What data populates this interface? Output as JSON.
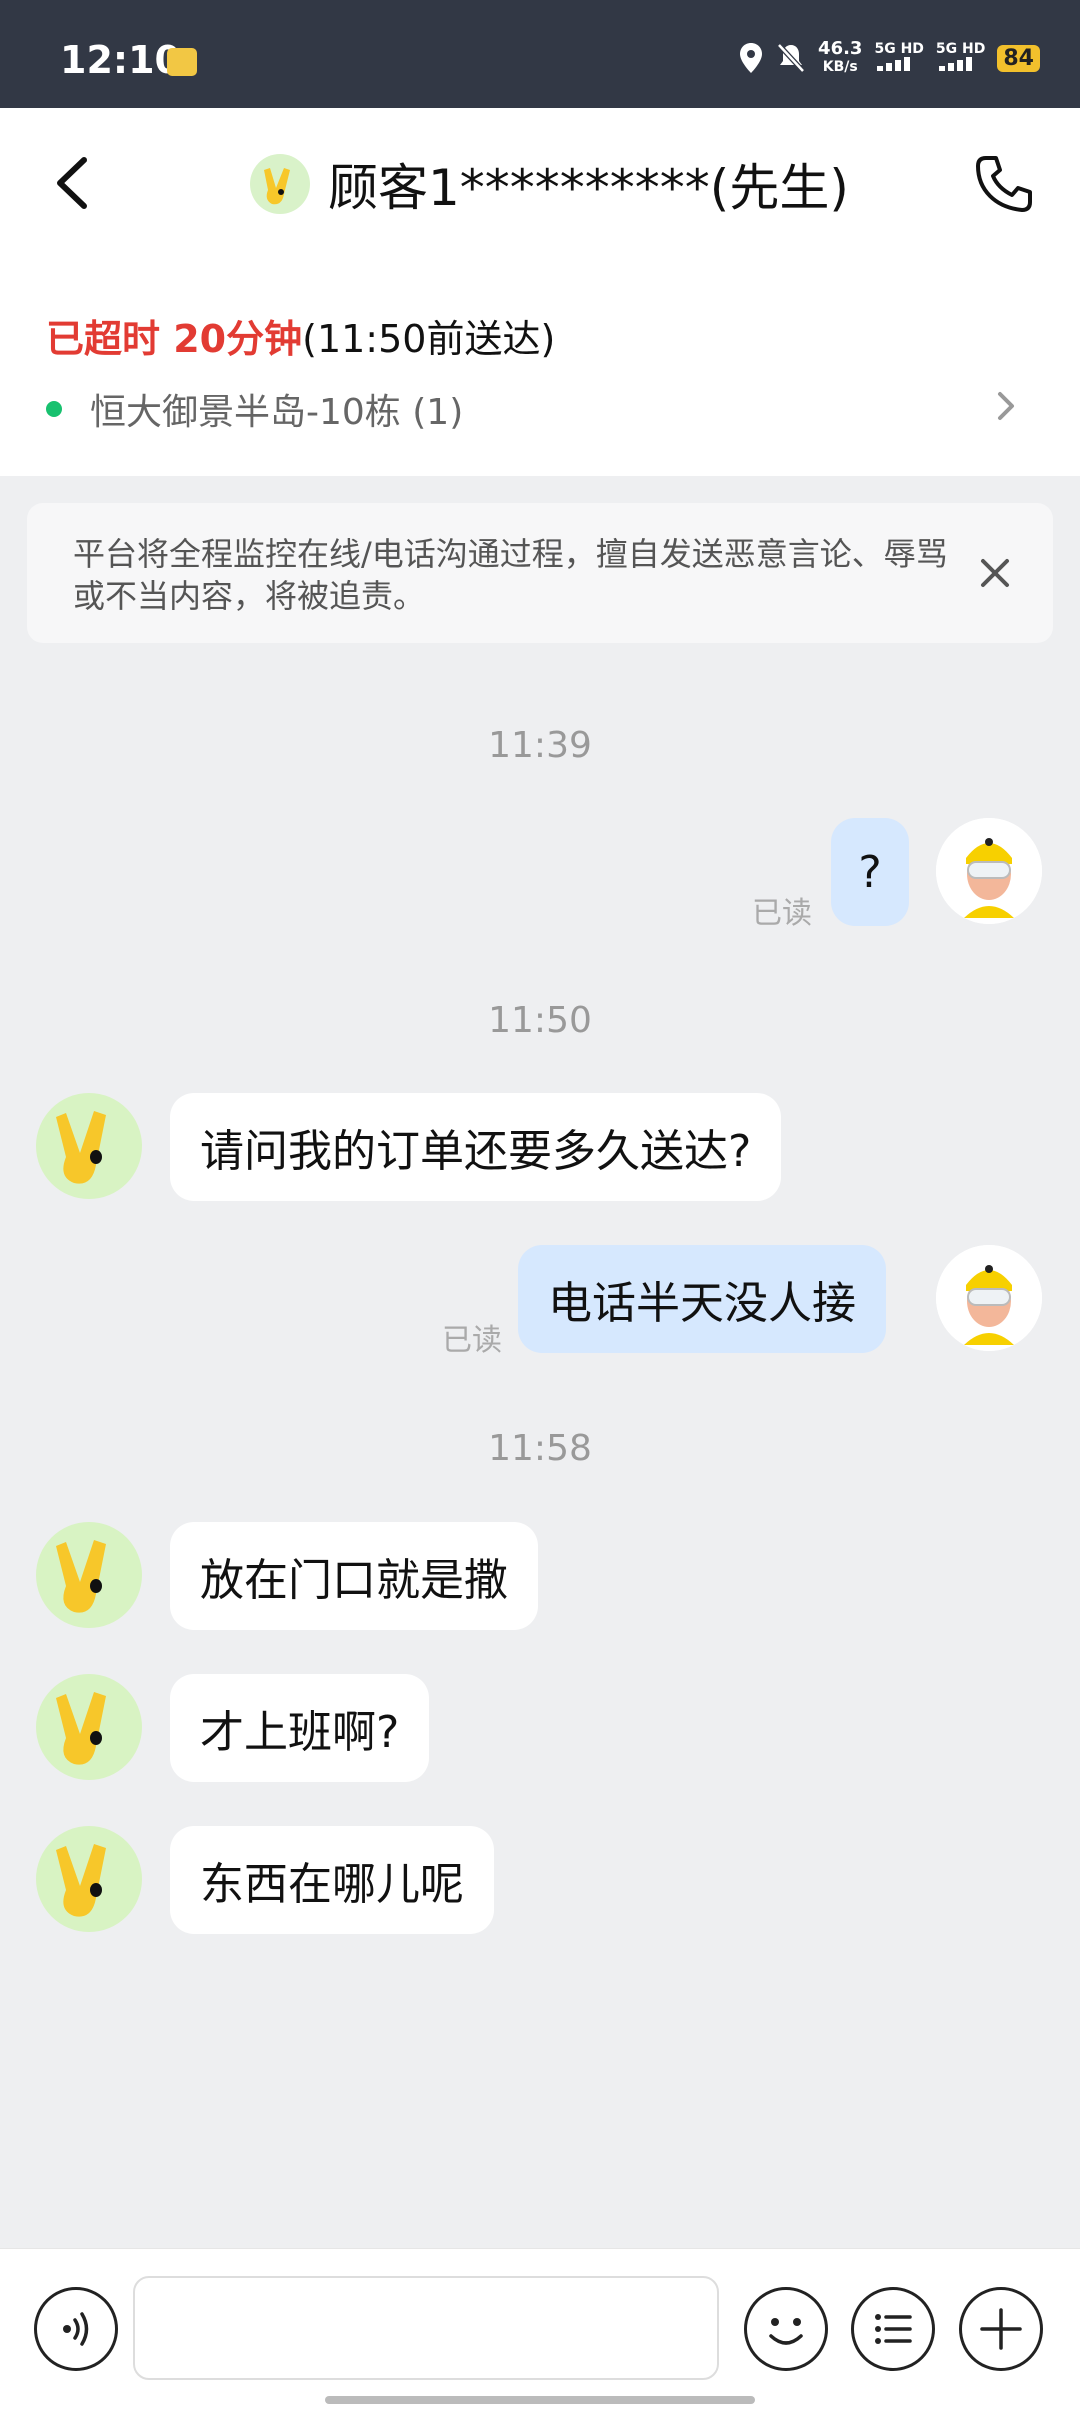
{
  "status_bar": {
    "time": "12:10",
    "speed_value": "46.3",
    "speed_unit": "KB/s",
    "sig1": "5G HD",
    "sig2": "5G HD",
    "battery": "84"
  },
  "header": {
    "title": "顾客1**********(先生)"
  },
  "order": {
    "overdue_text": "已超时 20分钟",
    "deadline_text": "(11:50前送达)",
    "address": "恒大御景半岛-10栋 (1)"
  },
  "notice": {
    "text": "平台将全程监控在线/电话沟通过程，擅自发送恶意言论、辱骂或不当内容，将被追责。"
  },
  "chat": {
    "ts1": "11:39",
    "m1": {
      "text": "?",
      "read": "已读"
    },
    "ts2": "11:50",
    "m2": {
      "text": "请问我的订单还要多久送达?"
    },
    "m3": {
      "text": "电话半天没人接",
      "read": "已读"
    },
    "ts3": "11:58",
    "m4": {
      "text": "放在门口就是撒"
    },
    "m5": {
      "text": "才上班啊?"
    },
    "m6": {
      "text": "东西在哪儿呢"
    }
  },
  "input": {
    "value": ""
  },
  "icons": [
    "back-icon",
    "phone-icon",
    "chevron-right-icon",
    "close-icon",
    "voice-icon",
    "emoji-icon",
    "menu-icon",
    "plus-icon"
  ],
  "colors": {
    "overdue": "#e23b33",
    "address_dot": "#18c16f",
    "my_bubble": "#d6e8fe"
  }
}
